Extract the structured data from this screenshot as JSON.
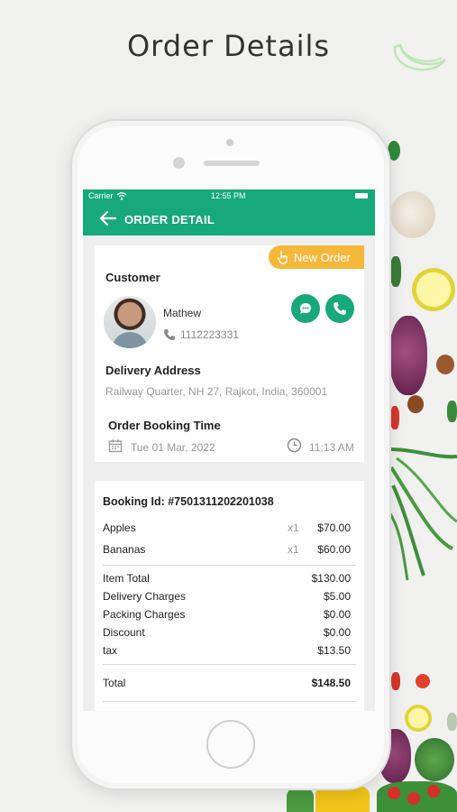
{
  "headline": "Order Details",
  "status_bar": {
    "carrier": "Carrier",
    "time": "12:55 PM"
  },
  "app_bar": {
    "back_icon": "arrow-left-icon",
    "title": "ORDER DETAIL"
  },
  "order_badge": {
    "icon": "hand-icon",
    "label": "New Order"
  },
  "customer": {
    "section_label": "Customer",
    "name": "Mathew",
    "phone": "1112223331",
    "actions": [
      "chat-icon",
      "phone-icon"
    ]
  },
  "delivery": {
    "section_label": "Delivery Address",
    "address": "Railway Quarter, NH 27, Rajkot, India, 360001"
  },
  "booking_time": {
    "section_label": "Order Booking Time",
    "date": "Tue 01 Mar, 2022",
    "time": "11:13 AM"
  },
  "summary": {
    "booking_id": "Booking Id: #7501311202201038",
    "items": [
      {
        "name": "Apples",
        "qty": "x1",
        "amount": "$70.00"
      },
      {
        "name": "Bananas",
        "qty": "x1",
        "amount": "$60.00"
      }
    ],
    "charges": [
      {
        "label": "Item Total",
        "amount": "$130.00"
      },
      {
        "label": "Delivery Charges",
        "amount": "$5.00"
      },
      {
        "label": "Packing Charges",
        "amount": "$0.00"
      },
      {
        "label": "Discount",
        "amount": "$0.00"
      },
      {
        "label": "tax",
        "amount": "$13.50"
      }
    ],
    "total_label": "Total",
    "total_amount": "$148.50"
  },
  "colors": {
    "primary": "#17a97a",
    "badge": "#f5b83a"
  }
}
